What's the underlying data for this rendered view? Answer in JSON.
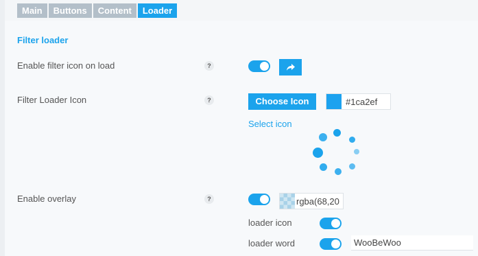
{
  "tabs": [
    {
      "label": "Main",
      "active": false
    },
    {
      "label": "Buttons",
      "active": false
    },
    {
      "label": "Content",
      "active": false
    },
    {
      "label": "Loader",
      "active": true
    }
  ],
  "section_title": "Filter loader",
  "help_glyph": "?",
  "rows": {
    "enable_filter_icon": {
      "label": "Enable filter icon on load",
      "toggle_on": true
    },
    "filter_loader_icon": {
      "label": "Filter Loader Icon",
      "choose_button": "Choose Icon",
      "color_value": "#1ca2ef",
      "select_icon_link": "Select icon"
    },
    "enable_overlay": {
      "label": "Enable overlay",
      "toggle_on": true,
      "overlay_color_value": "rgba(68,20"
    },
    "loader_icon": {
      "label": "loader icon",
      "toggle_on": true
    },
    "loader_word": {
      "label": "loader word",
      "toggle_on": true,
      "value": "WooBeWoo"
    }
  },
  "colors": {
    "accent": "#1ba3ec",
    "tab_inactive": "#b3bfc9",
    "icon_color": "#1ca2ef"
  },
  "icons": {
    "share": "share-arrow-icon",
    "spinner": "loader-spinner-icon",
    "help": "help-icon"
  }
}
